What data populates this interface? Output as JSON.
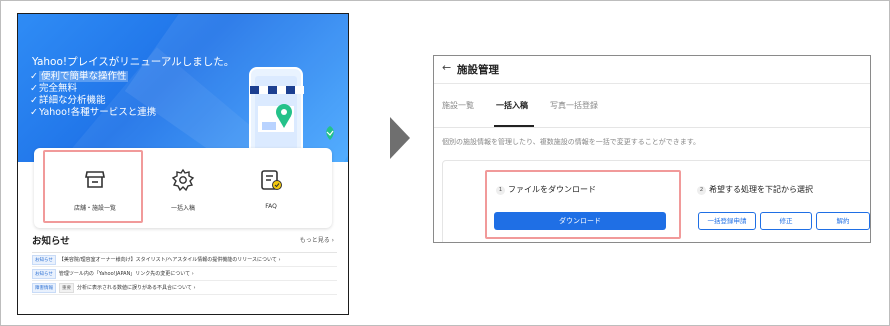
{
  "left_screen": {
    "hero": {
      "title": "Yahoo!プレイスがリニューアルしました。",
      "features": [
        {
          "check": "✓",
          "text": "便利で簡単な操作性"
        },
        {
          "check": "✓",
          "text": "完全無料"
        },
        {
          "check": "✓",
          "text": "詳細な分析機能"
        },
        {
          "check": "✓",
          "text": "Yahoo!各種サービスと連携"
        }
      ]
    },
    "menu": [
      {
        "label": "店舗・施設一覧",
        "icon": "store-icon"
      },
      {
        "label": "一括入稿",
        "icon": "gear-icon"
      },
      {
        "label": "FAQ",
        "icon": "faq-icon"
      }
    ],
    "news": {
      "heading": "お知らせ",
      "more": "もっと見る ›",
      "items": [
        {
          "badges": [
            "お知らせ"
          ],
          "text": "【美容院/理容室オーナー様向け】スタイリスト/ヘアスタイル情報の提供機能のリリースについて ›"
        },
        {
          "badges": [
            "お知らせ"
          ],
          "text": "管理ツール内の「Yahoo!JAPAN」リンク先の変更について ›"
        },
        {
          "badges": [
            "障害情報",
            "重要"
          ],
          "text": "分析に表示される数値に誤りがある不具合について ›"
        }
      ]
    }
  },
  "right_panel": {
    "back": "←",
    "title": "施設管理",
    "tabs": [
      "施設一覧",
      "一括入稿",
      "写真一括登録"
    ],
    "active_tab": "一括入稿",
    "description": "個別の施設情報を管理したり、複数施設の情報を一括で変更することができます。",
    "step1": {
      "num": "1",
      "title": "ファイルをダウンロード",
      "button": "ダウンロード"
    },
    "step2": {
      "num": "2",
      "title": "希望する処理を下記から選択",
      "buttons": [
        "一括登録申請",
        "修正",
        "解約"
      ]
    }
  },
  "colors": {
    "accent": "#1f6fe5",
    "highlight": "#f19a9a",
    "hero": "#2f8cf5"
  }
}
